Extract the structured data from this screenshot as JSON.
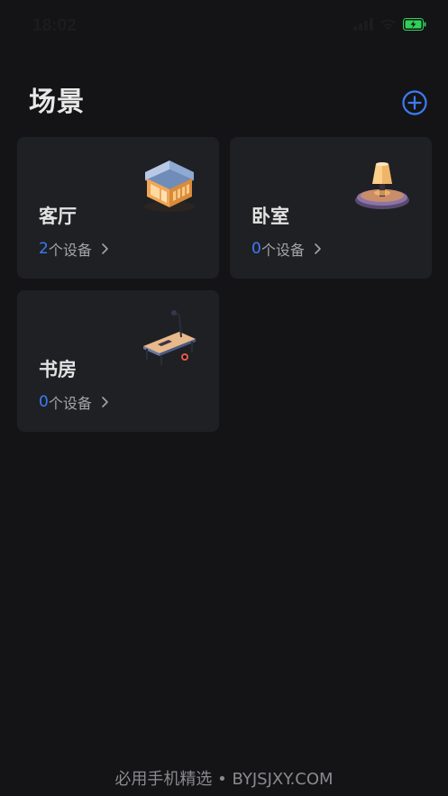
{
  "status_bar": {
    "time": "18:02",
    "icons": [
      "signal-icon",
      "wifi-icon",
      "battery-charging-icon"
    ],
    "battery_color": "#2fd158"
  },
  "header": {
    "title": "场景",
    "add_icon": "add-circle-icon",
    "accent_color": "#3d7bf7"
  },
  "rooms": [
    {
      "name": "客厅",
      "count": "2",
      "count_suffix": "个设备",
      "illustration": "house-icon"
    },
    {
      "name": "卧室",
      "count": "0",
      "count_suffix": "个设备",
      "illustration": "lamp-icon"
    },
    {
      "name": "书房",
      "count": "0",
      "count_suffix": "个设备",
      "illustration": "desk-icon"
    }
  ],
  "footer": {
    "watermark": "必用手机精选 • BYJSJXY.COM"
  }
}
